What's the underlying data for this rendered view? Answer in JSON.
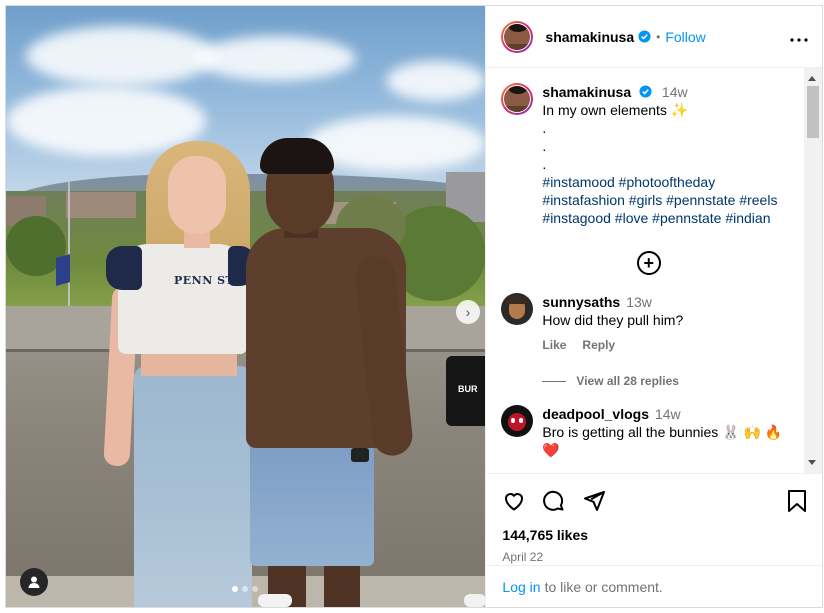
{
  "post": {
    "username": "shamakinusa",
    "separator": "•",
    "follow_label": "Follow",
    "more_label": "•••",
    "caption_time": "14w",
    "caption_lines": [
      "In my own elements",
      ".",
      ".",
      "."
    ],
    "caption_emoji": "✨",
    "hashtag_lines": [
      "#instamood #photooftheday",
      "#instafashion #girls #pennstate #reels",
      "#instagood #love #pennstate #indian"
    ],
    "add_label": "+",
    "likes": "144,765 likes",
    "date": "April 22"
  },
  "media": {
    "shirt_text": "PENN STATE",
    "bag_text": "BUR",
    "next_arrow": "›",
    "dots_count": 3,
    "active_dot": 1
  },
  "comments": [
    {
      "username": "sunnysaths",
      "time": "13w",
      "text": "How did they pull him?",
      "like_label": "Like",
      "reply_label": "Reply",
      "view_replies": "View all 28 replies"
    },
    {
      "username": "deadpool_vlogs",
      "time": "14w",
      "text": "Bro is getting all the bunnies 🐰 🙌 🔥",
      "text_line2": "❤️"
    }
  ],
  "footer": {
    "login_link": "Log in",
    "login_rest": "to like or comment."
  },
  "colors": {
    "link_blue": "#0095f6",
    "hashtag": "#00376b",
    "muted": "#737373",
    "verified": "#0095f6"
  },
  "icons": [
    "heart-icon",
    "comment-icon",
    "share-icon",
    "bookmark-icon",
    "verified-badge-icon",
    "add-circle-icon",
    "user-tag-icon",
    "more-options-icon",
    "next-arrow-icon"
  ]
}
